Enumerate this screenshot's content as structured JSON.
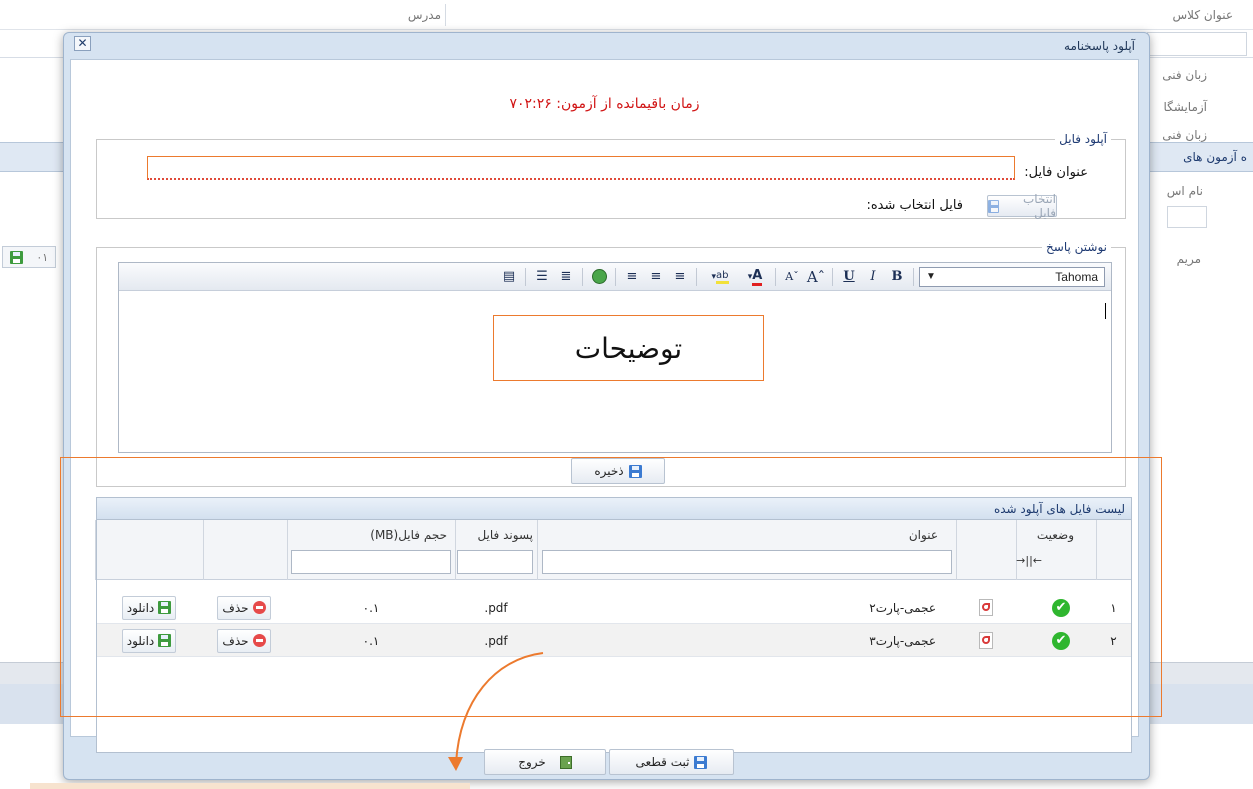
{
  "background": {
    "col_title": "عنوان کلاس",
    "col_teacher": "مدرس",
    "side_items": [
      "زبان فنی",
      "آزمایشگا",
      "زبان فنی"
    ],
    "bluebar_text": "ه آزمون های",
    "name_label": "نام اس",
    "student_name": "مریم",
    "small_btn": "۰۱"
  },
  "dialog": {
    "title": "آپلود پاسخنامه",
    "close_glyph": "✕",
    "timer_text": "زمان باقیمانده از آزمون: ۷۰۲:۲۶",
    "upload": {
      "legend": "آپلود فایل",
      "file_title_label": "عنوان فایل:",
      "file_title_value": "",
      "select_btn": "انتخاب فایل",
      "selected_label": "فایل انتخاب شده:"
    },
    "answer": {
      "legend": "نوشتن پاسخ",
      "font": "Tahoma",
      "toolbar": [
        "bold-icon",
        "italic-icon",
        "underline-icon",
        "grow-font-icon",
        "shrink-font-icon",
        "font-color-icon",
        "highlight-icon",
        "align-left-icon",
        "align-center-icon",
        "align-right-icon",
        "link-icon",
        "ordered-list-icon",
        "unordered-list-icon",
        "source-icon"
      ],
      "annotation": "توضیحات",
      "save_btn": "ذخیره"
    },
    "files": {
      "title": "لیست فایل های آپلود شده",
      "columns": {
        "status": "وضعیت",
        "title": "عنوان",
        "ext": "پسوند فایل",
        "size": "حجم فایل(MB)"
      },
      "resize_glyph": "←||→",
      "rows": [
        {
          "num": "۱",
          "title": "عجمی-پارت۲",
          "ext": "pdf.",
          "size": "۰.۱",
          "delete": "حذف",
          "download": "دانلود"
        },
        {
          "num": "۲",
          "title": "عجمی-پارت۳",
          "ext": "pdf.",
          "size": "۰.۱",
          "delete": "حذف",
          "download": "دانلود"
        }
      ]
    },
    "footer": {
      "final_btn": "ثبت قطعی",
      "exit_btn": "خروج"
    }
  },
  "colors": {
    "annotation": "#ec7a2e",
    "timer": "#d11414",
    "check": "#2fb62f"
  }
}
